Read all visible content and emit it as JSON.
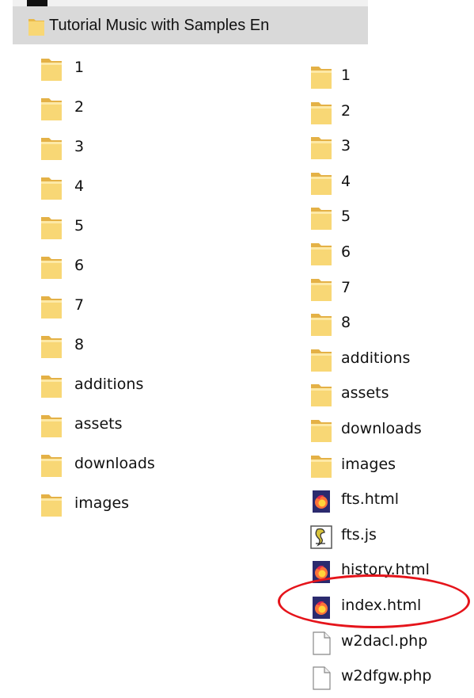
{
  "header": {
    "title": "Tutorial Music with Samples En"
  },
  "left_list": {
    "items": [
      {
        "label": "1",
        "icon": "folder-icon"
      },
      {
        "label": "2",
        "icon": "folder-icon"
      },
      {
        "label": "3",
        "icon": "folder-icon"
      },
      {
        "label": "4",
        "icon": "folder-icon"
      },
      {
        "label": "5",
        "icon": "folder-icon"
      },
      {
        "label": "6",
        "icon": "folder-icon"
      },
      {
        "label": "7",
        "icon": "folder-icon"
      },
      {
        "label": "8",
        "icon": "folder-icon"
      },
      {
        "label": "additions",
        "icon": "folder-icon"
      },
      {
        "label": "assets",
        "icon": "folder-icon"
      },
      {
        "label": "downloads",
        "icon": "folder-icon"
      },
      {
        "label": "images",
        "icon": "folder-icon"
      }
    ]
  },
  "right_list": {
    "items": [
      {
        "label": "1",
        "icon": "folder-icon"
      },
      {
        "label": "2",
        "icon": "folder-icon"
      },
      {
        "label": "3",
        "icon": "folder-icon"
      },
      {
        "label": "4",
        "icon": "folder-icon"
      },
      {
        "label": "5",
        "icon": "folder-icon"
      },
      {
        "label": "6",
        "icon": "folder-icon"
      },
      {
        "label": "7",
        "icon": "folder-icon"
      },
      {
        "label": "8",
        "icon": "folder-icon"
      },
      {
        "label": "additions",
        "icon": "folder-icon"
      },
      {
        "label": "assets",
        "icon": "folder-icon"
      },
      {
        "label": "downloads",
        "icon": "folder-icon"
      },
      {
        "label": "images",
        "icon": "folder-icon"
      },
      {
        "label": "fts.html",
        "icon": "firefox-html-icon"
      },
      {
        "label": "fts.js",
        "icon": "script-file-icon"
      },
      {
        "label": "history.html",
        "icon": "firefox-html-icon"
      },
      {
        "label": "index.html",
        "icon": "firefox-html-icon",
        "highlighted": true
      },
      {
        "label": "w2dacl.php",
        "icon": "blank-file-icon"
      },
      {
        "label": "w2dfgw.php",
        "icon": "blank-file-icon"
      }
    ]
  },
  "colors": {
    "folder_fill": "#f8d775",
    "folder_light": "#fde9a6",
    "header_bg": "#d9d9d9",
    "highlight_ring": "#e5141b"
  }
}
